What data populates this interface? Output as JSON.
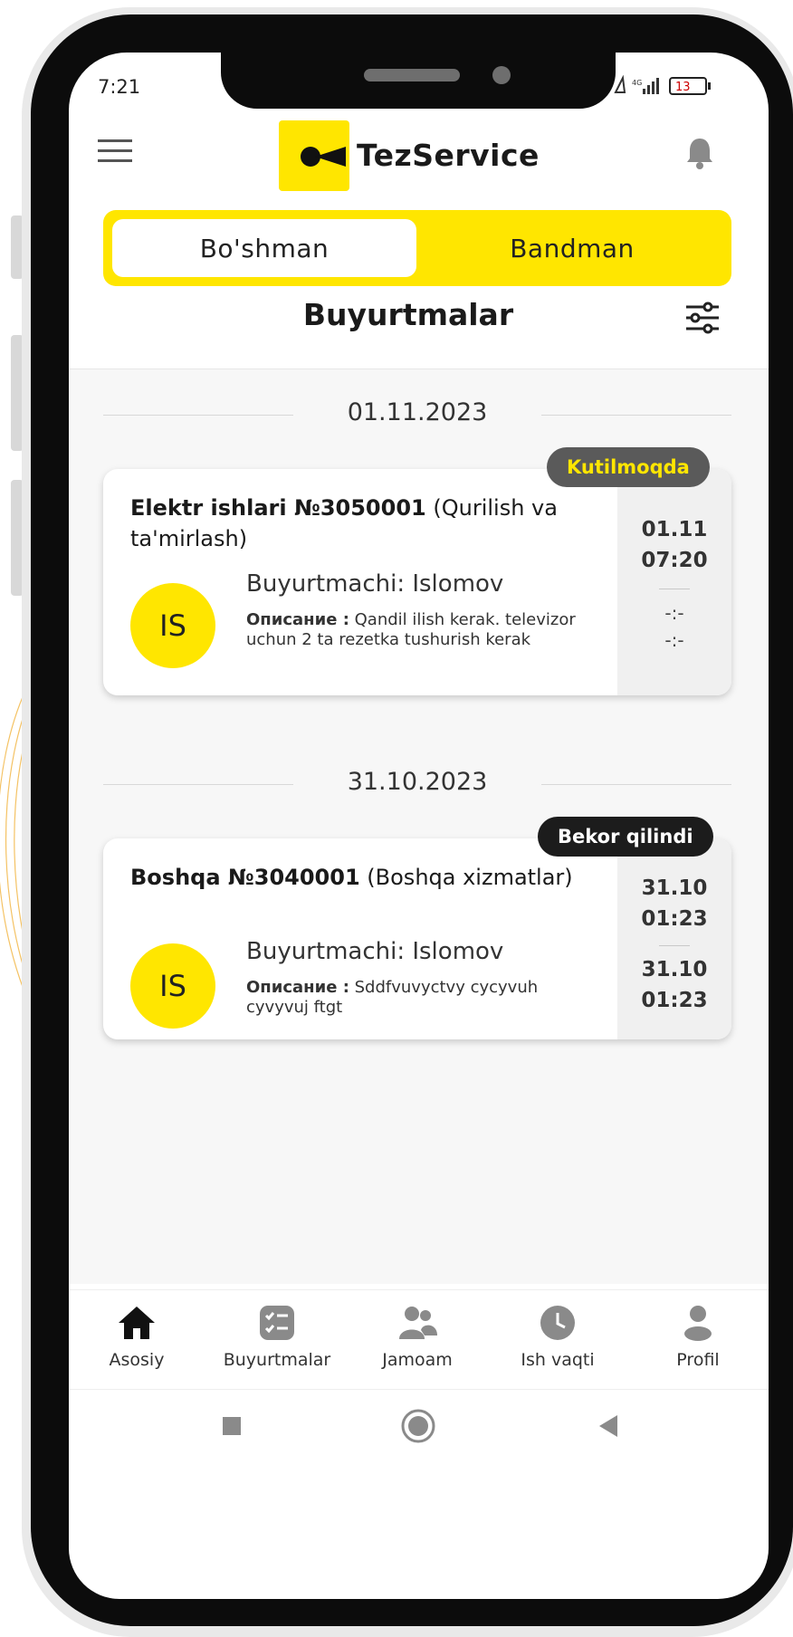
{
  "status_bar": {
    "time": "7:21",
    "battery": "13"
  },
  "header": {
    "brand": "TezService"
  },
  "segment": {
    "active_label": "Bo'shman",
    "inactive_label": "Bandman"
  },
  "page": {
    "title": "Buyurtmalar"
  },
  "groups": [
    {
      "date": "01.11.2023",
      "order": {
        "status": "Kutilmoqda",
        "title_bold": "Elektr ishlari №3050001",
        "title_rest": "(Qurilish va ta'mirlash)",
        "avatar": "IS",
        "customer": "Buyurtmachi: Islomov",
        "desc_label": "Описание :",
        "desc_text": "Qandil ilish kerak. televizor uchun 2 ta rezetka tushurish kerak",
        "start_date": "01.11",
        "start_time": "07:20",
        "end_date": "-:-",
        "end_time": "-:-"
      }
    },
    {
      "date": "31.10.2023",
      "order": {
        "status": "Bekor qilindi",
        "title_bold": "Boshqa №3040001",
        "title_rest": "(Boshqa xizmatlar)",
        "avatar": "IS",
        "customer": "Buyurtmachi: Islomov",
        "desc_label": "Описание :",
        "desc_text": "Sddfvuvyctvy cycyvuh cyvyvuj ftgt",
        "start_date": "31.10",
        "start_time": "01:23",
        "end_date": "31.10",
        "end_time": "01:23"
      }
    }
  ],
  "nav": {
    "items": [
      {
        "label": "Asosiy",
        "icon": "home-icon"
      },
      {
        "label": "Buyurtmalar",
        "icon": "orders-list-icon"
      },
      {
        "label": "Jamoam",
        "icon": "team-icon"
      },
      {
        "label": "Ish vaqti",
        "icon": "clock-icon"
      },
      {
        "label": "Profil",
        "icon": "profile-icon"
      }
    ]
  },
  "colors": {
    "accent": "#ffe600",
    "badge_waiting": "#5a5a5a",
    "badge_cancelled": "#1c1c1c"
  }
}
